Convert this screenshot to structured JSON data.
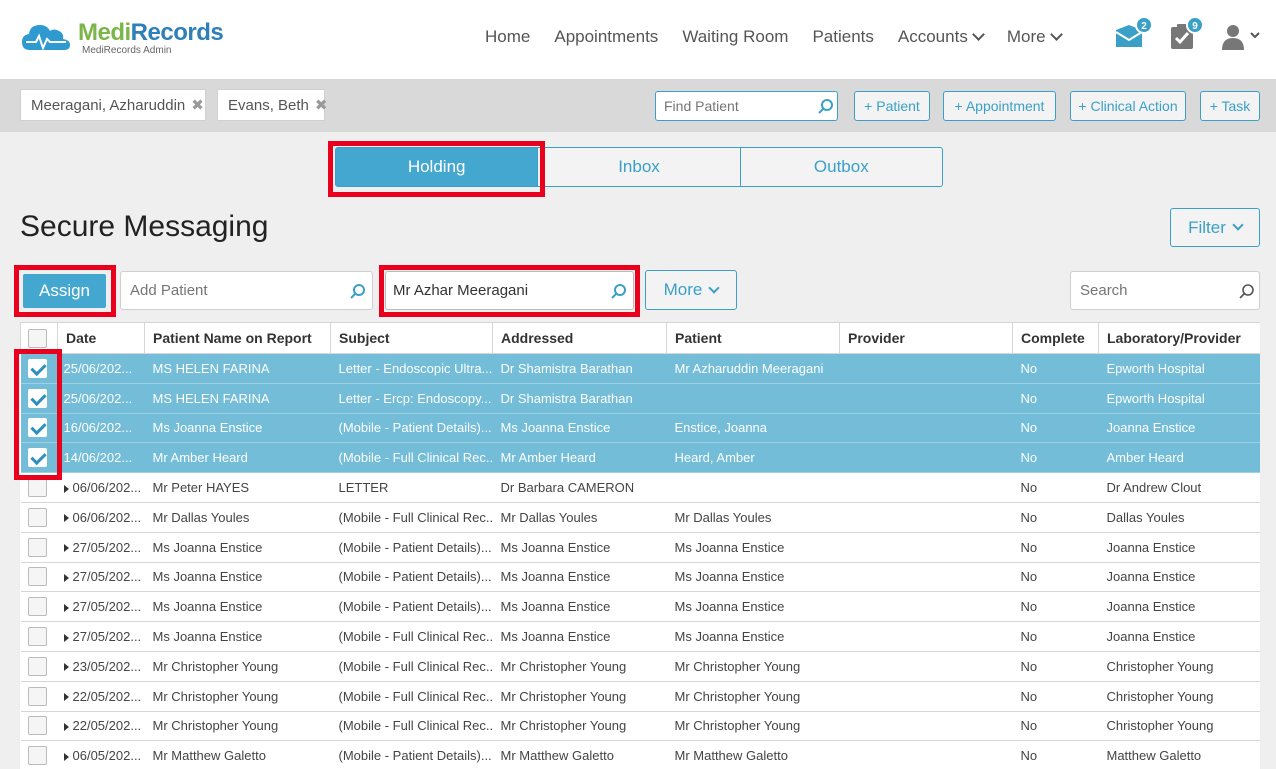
{
  "brand": {
    "name_part1": "Medi",
    "name_part2": "Records",
    "subtitle": "MediRecords Admin"
  },
  "nav": {
    "items": [
      "Home",
      "Appointments",
      "Waiting Room",
      "Patients",
      "Accounts",
      "More"
    ],
    "messages_badge": "2",
    "tasks_badge": "9"
  },
  "patient_tabs": [
    "Meeragani, Azharuddin",
    "Evans, Beth"
  ],
  "find_patient": {
    "placeholder": "Find Patient"
  },
  "quick_actions": [
    "+ Patient",
    "+ Appointment",
    "+ Clinical Action",
    "+ Task"
  ],
  "message_tabs": [
    "Holding",
    "Inbox",
    "Outbox"
  ],
  "page_title": "Secure Messaging",
  "filter_label": "Filter",
  "assign_label": "Assign",
  "add_patient": {
    "placeholder": "Add Patient"
  },
  "patient_search": {
    "value": "Mr Azhar Meeragani"
  },
  "more_label": "More",
  "search": {
    "placeholder": "Search"
  },
  "colors": {
    "accent": "#44a7cf",
    "selected_row": "#73bdd8",
    "highlight": "#e8001c",
    "brand_green": "#7ab648",
    "brand_blue": "#2f7fb8"
  },
  "table": {
    "columns": [
      "Date",
      "Patient Name on Report",
      "Subject",
      "Addressed",
      "Patient",
      "Provider",
      "Complete",
      "Laboratory/Provider"
    ],
    "rows": [
      {
        "selected": true,
        "date": "25/06/202...",
        "name": "MS HELEN FARINA",
        "subject": "Letter - Endoscopic Ultra...",
        "addressed": "Dr Shamistra Barathan",
        "patient": "Mr Azharuddin Meeragani",
        "provider": "",
        "complete": "No",
        "lab": "Epworth Hospital"
      },
      {
        "selected": true,
        "date": "25/06/202...",
        "name": "MS HELEN FARINA",
        "subject": "Letter - Ercp: Endoscopy...",
        "addressed": "Dr Shamistra Barathan",
        "patient": "",
        "provider": "",
        "complete": "No",
        "lab": "Epworth Hospital"
      },
      {
        "selected": true,
        "date": "16/06/202...",
        "name": "Ms Joanna Enstice",
        "subject": "(Mobile - Patient Details)...",
        "addressed": "Ms Joanna Enstice",
        "patient": "Enstice, Joanna",
        "provider": "",
        "complete": "No",
        "lab": "Joanna Enstice"
      },
      {
        "selected": true,
        "date": "14/06/202...",
        "name": "Mr Amber Heard",
        "subject": "(Mobile - Full Clinical Rec...",
        "addressed": "Mr Amber Heard",
        "patient": "Heard, Amber",
        "provider": "",
        "complete": "No",
        "lab": "Amber Heard"
      },
      {
        "selected": false,
        "date": "06/06/202...",
        "name": "Mr Peter HAYES",
        "subject": "LETTER",
        "addressed": "Dr Barbara CAMERON",
        "patient": "",
        "provider": "",
        "complete": "No",
        "lab": "Dr Andrew Clout"
      },
      {
        "selected": false,
        "date": "06/06/202...",
        "name": "Mr Dallas Youles",
        "subject": "(Mobile - Full Clinical Rec...",
        "addressed": "Mr Dallas Youles",
        "patient": "Mr Dallas Youles",
        "provider": "",
        "complete": "No",
        "lab": "Dallas Youles"
      },
      {
        "selected": false,
        "date": "27/05/202...",
        "name": "Ms Joanna Enstice",
        "subject": "(Mobile - Patient Details)...",
        "addressed": "Ms Joanna Enstice",
        "patient": "Ms Joanna Enstice",
        "provider": "",
        "complete": "No",
        "lab": "Joanna Enstice"
      },
      {
        "selected": false,
        "date": "27/05/202...",
        "name": "Ms Joanna Enstice",
        "subject": "(Mobile - Patient Details)...",
        "addressed": "Ms Joanna Enstice",
        "patient": "Ms Joanna Enstice",
        "provider": "",
        "complete": "No",
        "lab": "Joanna Enstice"
      },
      {
        "selected": false,
        "date": "27/05/202...",
        "name": "Ms Joanna Enstice",
        "subject": "(Mobile - Patient Details)...",
        "addressed": "Ms Joanna Enstice",
        "patient": "Ms Joanna Enstice",
        "provider": "",
        "complete": "No",
        "lab": "Joanna Enstice"
      },
      {
        "selected": false,
        "date": "27/05/202...",
        "name": "Ms Joanna Enstice",
        "subject": "(Mobile - Full Clinical Rec...",
        "addressed": "Ms Joanna Enstice",
        "patient": "Ms Joanna Enstice",
        "provider": "",
        "complete": "No",
        "lab": "Joanna Enstice"
      },
      {
        "selected": false,
        "date": "23/05/202...",
        "name": "Mr Christopher Young",
        "subject": "(Mobile - Full Clinical Rec...",
        "addressed": "Mr Christopher Young",
        "patient": "Mr Christopher Young",
        "provider": "",
        "complete": "No",
        "lab": "Christopher Young"
      },
      {
        "selected": false,
        "date": "22/05/202...",
        "name": "Mr Christopher Young",
        "subject": "(Mobile - Full Clinical Rec...",
        "addressed": "Mr Christopher Young",
        "patient": "Mr Christopher Young",
        "provider": "",
        "complete": "No",
        "lab": "Christopher Young"
      },
      {
        "selected": false,
        "date": "22/05/202...",
        "name": "Mr Christopher Young",
        "subject": "(Mobile - Full Clinical Rec...",
        "addressed": "Mr Christopher Young",
        "patient": "Mr Christopher Young",
        "provider": "",
        "complete": "No",
        "lab": "Christopher Young"
      },
      {
        "selected": false,
        "date": "06/05/202...",
        "name": "Mr Matthew Galetto",
        "subject": "(Mobile - Patient Details)...",
        "addressed": "Mr Matthew Galetto",
        "patient": "Mr Matthew Galetto",
        "provider": "",
        "complete": "No",
        "lab": "Matthew Galetto"
      }
    ]
  }
}
